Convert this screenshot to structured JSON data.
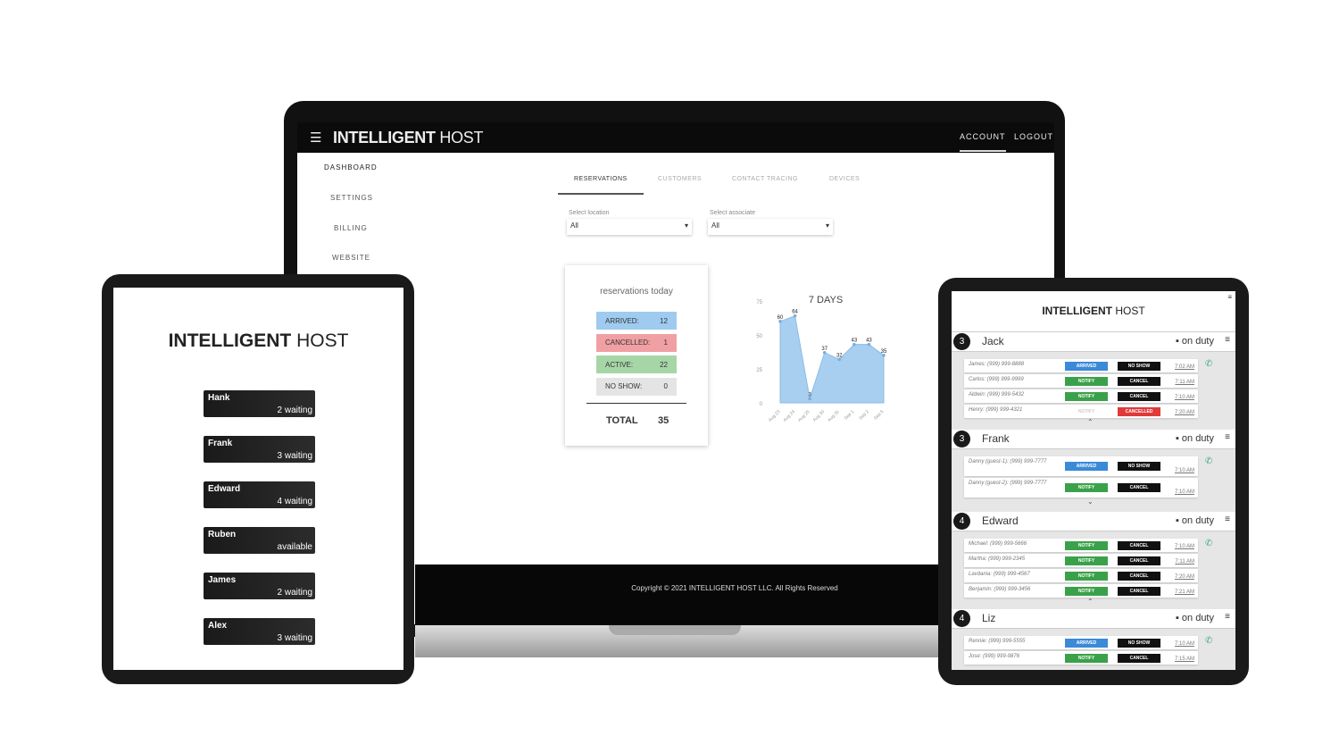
{
  "laptop": {
    "brand_bold": "INTELLIGENT",
    "brand_light": "HOST",
    "nav": {
      "account": "ACCOUNT",
      "logout": "LOGOUT"
    },
    "sidebar": [
      "DASHBOARD",
      "SETTINGS",
      "BILLING",
      "WEBSITE"
    ],
    "tabs": [
      "RESERVATIONS",
      "CUSTOMERS",
      "CONTACT TRACING",
      "DEVICES"
    ],
    "filters": [
      {
        "label": "Select location",
        "value": "All"
      },
      {
        "label": "Select associate",
        "value": "All"
      }
    ],
    "card": {
      "title": "reservations today",
      "stats": [
        {
          "label": "ARRIVED:",
          "value": "12",
          "color": "#9ecbef"
        },
        {
          "label": "CANCELLED:",
          "value": "1",
          "color": "#f0a0a3"
        },
        {
          "label": "ACTIVE:",
          "value": "22",
          "color": "#a6d6a6"
        },
        {
          "label": "NO SHOW:",
          "value": "0",
          "color": "#e4e4e4"
        }
      ],
      "total_label": "TOTAL",
      "total_value": "35"
    },
    "footer": "Copyright © 2021 INTELLIGENT HOST LLC. All Rights Reserved"
  },
  "chart_data": {
    "type": "area",
    "title": "7 DAYS",
    "categories": [
      "Aug 23",
      "Aug 24",
      "Aug 25",
      "Aug 30",
      "Aug 31",
      "Sep 1",
      "Sep 2",
      "Sep 5"
    ],
    "values": [
      60,
      64,
      3,
      37,
      32,
      43,
      43,
      35
    ],
    "yticks": [
      0,
      25,
      50,
      75
    ],
    "ylim": [
      0,
      75
    ],
    "color": "#a8cff0"
  },
  "tablet_left": {
    "brand_bold": "INTELLIGENT",
    "brand_light": "HOST",
    "hosts": [
      {
        "name": "Hank",
        "status": "2 waiting"
      },
      {
        "name": "Frank",
        "status": "3 waiting"
      },
      {
        "name": "Edward",
        "status": "4 waiting"
      },
      {
        "name": "Ruben",
        "status": "available"
      },
      {
        "name": "James",
        "status": "2 waiting"
      },
      {
        "name": "Alex",
        "status": "3 waiting"
      }
    ]
  },
  "tablet_right": {
    "brand_bold": "INTELLIGENT",
    "brand_light": "HOST",
    "sections": [
      {
        "count": "3",
        "name": "Jack",
        "duty": "on duty",
        "rows": [
          {
            "guest": "James: (999) 999-8888",
            "b1": "ARRIVED",
            "b1c": "#3a8ad8",
            "b2": "NO SHOW",
            "b2c": "#111",
            "time": "7:02 AM"
          },
          {
            "guest": "Carlos: (999) 999-9999",
            "b1": "NOTIFY",
            "b1c": "#3aa14a",
            "b2": "CANCEL",
            "b2c": "#111",
            "time": "7:11 AM"
          },
          {
            "guest": "Aldwin: (999) 999-5432",
            "b1": "NOTIFY",
            "b1c": "#3aa14a",
            "b2": "CANCEL",
            "b2c": "#111",
            "time": "7:10 AM"
          },
          {
            "guest": "Henry: (999) 999-4321",
            "b1": "NOTIFY",
            "b1c": "#fff",
            "b2": "CANCELLED",
            "b2c": "#e03a3a",
            "time": "7:20 AM"
          }
        ]
      },
      {
        "count": "3",
        "name": "Frank",
        "duty": "on duty",
        "rows": [
          {
            "guest": "Danny (guest-1): (999) 999-7777",
            "b1": "ARRIVED",
            "b1c": "#3a8ad8",
            "b2": "NO SHOW",
            "b2c": "#111",
            "time": "7:10 AM"
          },
          {
            "guest": "Danny (guest-2): (999) 999-7777",
            "b1": "NOTIFY",
            "b1c": "#3aa14a",
            "b2": "CANCEL",
            "b2c": "#111",
            "time": "7:10 AM"
          }
        ]
      },
      {
        "count": "4",
        "name": "Edward",
        "duty": "on duty",
        "rows": [
          {
            "guest": "Michael: (999) 999-5666",
            "b1": "NOTIFY",
            "b1c": "#3aa14a",
            "b2": "CANCEL",
            "b2c": "#111",
            "time": "7:10 AM"
          },
          {
            "guest": "Martha: (999) 999-2345",
            "b1": "NOTIFY",
            "b1c": "#3aa14a",
            "b2": "CANCEL",
            "b2c": "#111",
            "time": "7:11 AM"
          },
          {
            "guest": "Lavdania: (999) 999-4567",
            "b1": "NOTIFY",
            "b1c": "#3aa14a",
            "b2": "CANCEL",
            "b2c": "#111",
            "time": "7:20 AM"
          },
          {
            "guest": "Benjamin: (999) 999-3456",
            "b1": "NOTIFY",
            "b1c": "#3aa14a",
            "b2": "CANCEL",
            "b2c": "#111",
            "time": "7:21 AM"
          }
        ]
      },
      {
        "count": "4",
        "name": "Liz",
        "duty": "on duty",
        "rows": [
          {
            "guest": "Rennie: (999) 999-5555",
            "b1": "ARRIVED",
            "b1c": "#3a8ad8",
            "b2": "NO SHOW",
            "b2c": "#111",
            "time": "7:10 AM"
          },
          {
            "guest": "Jose: (999) 999-9876",
            "b1": "NOTIFY",
            "b1c": "#3aa14a",
            "b2": "CANCEL",
            "b2c": "#111",
            "time": "7:15 AM"
          }
        ]
      }
    ]
  }
}
